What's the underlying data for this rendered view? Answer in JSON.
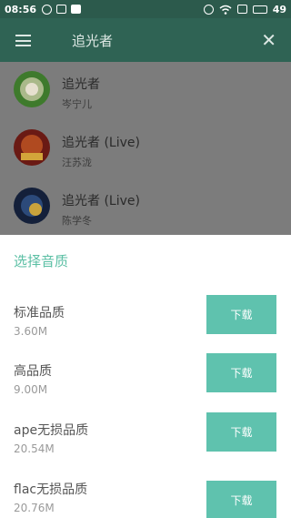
{
  "status_bar": {
    "time": "08:56",
    "battery": "49"
  },
  "app_bar": {
    "title": "追光者"
  },
  "songs": [
    {
      "title": "追光者",
      "artist": "岑宁儿"
    },
    {
      "title": "追光者 (Live)",
      "artist": "汪苏泷"
    },
    {
      "title": "追光者 (Live)",
      "artist": "陈学冬"
    }
  ],
  "sheet": {
    "title": "选择音质",
    "options": [
      {
        "label": "标准品质",
        "size": "3.60M",
        "button": "下载"
      },
      {
        "label": "高品质",
        "size": "9.00M",
        "button": "下载"
      },
      {
        "label": "ape无损品质",
        "size": "20.54M",
        "button": "下载"
      },
      {
        "label": "flac无损品质",
        "size": "20.76M",
        "button": "下载"
      }
    ]
  },
  "colors": {
    "accent": "#5fc2ae",
    "app_bar": "#2f6354",
    "status_bar": "#2c5a4c"
  }
}
